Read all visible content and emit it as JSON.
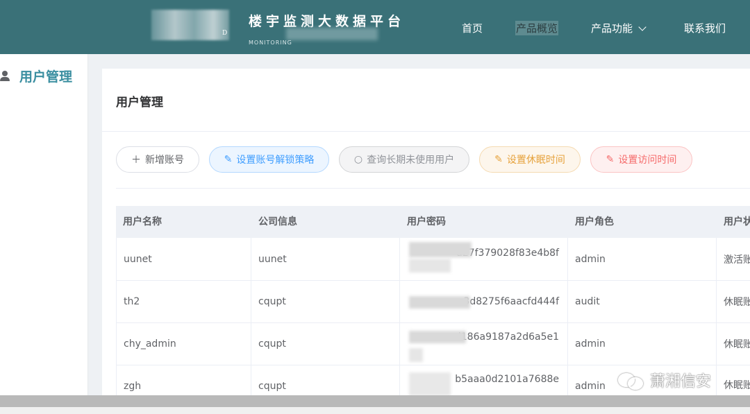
{
  "header": {
    "title": "楼宇监测大数据平台",
    "subtitle": "MONITORING",
    "logo_letter": "D",
    "nav": [
      {
        "label": "首页"
      },
      {
        "label": "产品概览"
      },
      {
        "label": "产品功能"
      },
      {
        "label": "联系我们"
      }
    ]
  },
  "sidebar": {
    "items": [
      {
        "label": "用户管理",
        "icon": "person-icon"
      }
    ]
  },
  "main": {
    "title": "用户管理",
    "buttons": [
      {
        "label": "新增账号",
        "icon": "plus-icon"
      },
      {
        "label": "设置账号解锁策略",
        "icon": "edit-icon"
      },
      {
        "label": "查询长期未使用用户",
        "icon": "search-icon"
      },
      {
        "label": "设置休眠时间",
        "icon": "edit-icon"
      },
      {
        "label": "设置访问时间",
        "icon": "edit-icon"
      }
    ],
    "table": {
      "columns": [
        "用户名称",
        "公司信息",
        "用户密码",
        "用户角色",
        "用户状"
      ],
      "rows": [
        {
          "name": "uunet",
          "company": "uunet",
          "password": "a27f379028f83e4b8f",
          "role": "admin",
          "status": "激活账"
        },
        {
          "name": "th2",
          "company": "cqupt",
          "password": "c3d8275f6aacfd444f",
          "role": "audit",
          "status": "休眠账"
        },
        {
          "name": "chy_admin",
          "company": "cqupt",
          "password": "d186a9187a2d6a5e1",
          "role": "admin",
          "status": "休眠账"
        },
        {
          "name": "zgh",
          "company": "cqupt",
          "password": "b5aaa0d2101a7688e",
          "role": "admin",
          "status": "休眠账"
        }
      ]
    }
  },
  "watermark": {
    "text": "萧湘信安"
  },
  "colors": {
    "header_bg": "#3a7178",
    "accent": "#3a8ea0"
  }
}
